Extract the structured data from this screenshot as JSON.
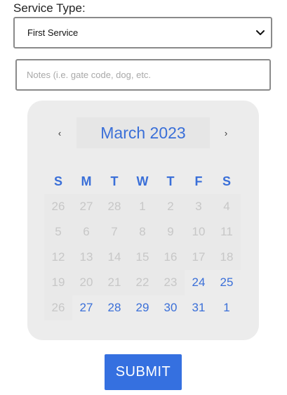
{
  "form": {
    "service_label": "Service Type:",
    "service_value": "First Service",
    "notes_placeholder": "Notes (i.e. gate code, dog, etc.",
    "notes_value": "",
    "submit_label": "SUBMIT"
  },
  "calendar": {
    "prev_glyph": "‹",
    "next_glyph": "›",
    "month_label": "March 2023",
    "weekdays": [
      "S",
      "M",
      "T",
      "W",
      "T",
      "F",
      "S"
    ],
    "weeks": [
      [
        {
          "d": "26",
          "available": false
        },
        {
          "d": "27",
          "available": false
        },
        {
          "d": "28",
          "available": false
        },
        {
          "d": "1",
          "available": false
        },
        {
          "d": "2",
          "available": false
        },
        {
          "d": "3",
          "available": false
        },
        {
          "d": "4",
          "available": false
        }
      ],
      [
        {
          "d": "5",
          "available": false
        },
        {
          "d": "6",
          "available": false
        },
        {
          "d": "7",
          "available": false
        },
        {
          "d": "8",
          "available": false
        },
        {
          "d": "9",
          "available": false
        },
        {
          "d": "10",
          "available": false
        },
        {
          "d": "11",
          "available": false
        }
      ],
      [
        {
          "d": "12",
          "available": false
        },
        {
          "d": "13",
          "available": false
        },
        {
          "d": "14",
          "available": false
        },
        {
          "d": "15",
          "available": false
        },
        {
          "d": "16",
          "available": false
        },
        {
          "d": "17",
          "available": false
        },
        {
          "d": "18",
          "available": false
        }
      ],
      [
        {
          "d": "19",
          "available": false
        },
        {
          "d": "20",
          "available": false
        },
        {
          "d": "21",
          "available": false
        },
        {
          "d": "22",
          "available": false
        },
        {
          "d": "23",
          "available": false
        },
        {
          "d": "24",
          "available": true
        },
        {
          "d": "25",
          "available": true
        }
      ],
      [
        {
          "d": "26",
          "available": false
        },
        {
          "d": "27",
          "available": true
        },
        {
          "d": "28",
          "available": true
        },
        {
          "d": "29",
          "available": true
        },
        {
          "d": "30",
          "available": true
        },
        {
          "d": "31",
          "available": true
        },
        {
          "d": "1",
          "available": true
        }
      ]
    ]
  },
  "colors": {
    "accent": "#3a6fd8",
    "button": "#3570e0",
    "disabled_text": "#c7c7c7",
    "calendar_bg": "#ececec"
  },
  "icons": {
    "select_arrow": "chevron-down-icon",
    "prev": "chevron-left-icon",
    "next": "chevron-right-icon"
  }
}
